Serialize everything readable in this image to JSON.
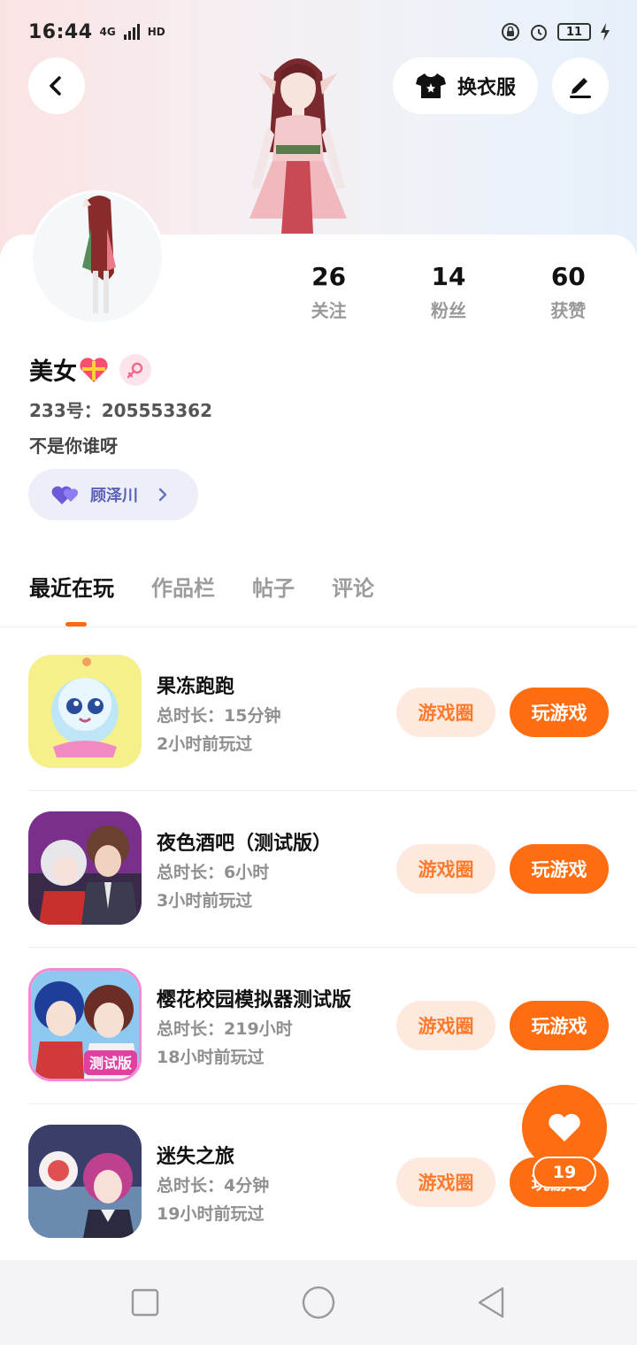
{
  "status_bar": {
    "time": "16:44",
    "network": "4G",
    "hd": "HD",
    "battery": "11"
  },
  "header": {
    "dress_up_label": "换衣服"
  },
  "profile": {
    "stats": [
      {
        "value": "26",
        "label": "关注"
      },
      {
        "value": "14",
        "label": "粉丝"
      },
      {
        "value": "60",
        "label": "获赞"
      }
    ],
    "name": "美女",
    "uid_text": "233号：205553362",
    "bio": "不是你谁呀",
    "cp_name": "顾泽川"
  },
  "tabs": [
    {
      "label": "最近在玩",
      "active": true
    },
    {
      "label": "作品栏",
      "active": false
    },
    {
      "label": "帖子",
      "active": false
    },
    {
      "label": "评论",
      "active": false
    }
  ],
  "games": [
    {
      "title": "果冻跑跑",
      "duration": "总时长：15分钟",
      "last_played": "2小时前玩过",
      "circle_label": "游戏圈",
      "play_label": "玩游戏"
    },
    {
      "title": "夜色酒吧（测试版）",
      "duration": "总时长：6小时",
      "last_played": "3小时前玩过",
      "circle_label": "游戏圈",
      "play_label": "玩游戏"
    },
    {
      "title": "樱花校园模拟器测试版",
      "duration": "总时长：219小时",
      "last_played": "18小时前玩过",
      "circle_label": "游戏圈",
      "play_label": "玩游戏",
      "icon_badge": "测试版"
    },
    {
      "title": "迷失之旅",
      "duration": "总时长：4分钟",
      "last_played": "19小时前玩过",
      "circle_label": "游戏圈",
      "play_label": "玩游戏"
    }
  ],
  "like_fab": {
    "count": "19"
  },
  "colors": {
    "accent": "#ff6d12",
    "accent_light": "#fde9de",
    "cp_chip_bg": "#eceef8",
    "cp_text": "#5a5fb8"
  }
}
